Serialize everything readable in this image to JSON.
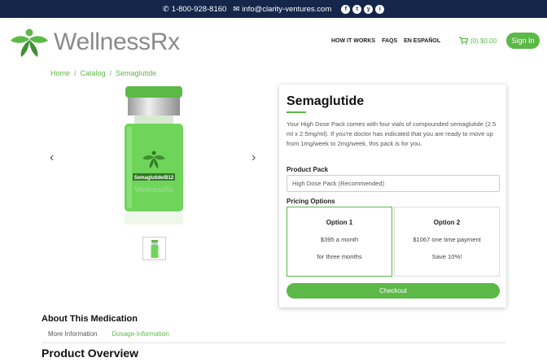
{
  "topbar": {
    "phone": "1-800-928-8160",
    "email": "info@clarity-ventures.com",
    "social": [
      "f",
      "t",
      "y",
      "i"
    ]
  },
  "brand": {
    "name_part1": "Wellness",
    "name_part2": "Rx",
    "accent": "#5cb947",
    "navy": "#14264a"
  },
  "nav": {
    "items": [
      "HOW IT WORKS",
      "FAQS",
      "EN ESPAÑOL"
    ]
  },
  "cart": {
    "label": "(0) $0.00"
  },
  "signin": {
    "label": "Sign In"
  },
  "breadcrumb": {
    "items": [
      "Home",
      "Catalog",
      "Semaglutide"
    ],
    "separator": "/"
  },
  "gallery": {
    "vial_label": "Semaglutide/B12",
    "vial_brand": "WellnessRx"
  },
  "product": {
    "title": "Semaglutide",
    "description": "Your High Dose Pack comes with four vials of compounded semaglutide (2.5 ml x 2.5mg/ml). If you're doctor has indicated that you are ready to move up from 1mg/week to 2mg/week, this pack is for you.",
    "pack_label": "Product Pack",
    "pack_value": "High Dose Pack (Recommended)",
    "pricing_label": "Pricing Options",
    "options": [
      {
        "title": "Option 1",
        "line1": "$395 a month",
        "line2": "for three months"
      },
      {
        "title": "Option 2",
        "line1": "$1067 one time payment",
        "line2": "Save 10%!"
      }
    ],
    "checkout_label": "Checkout"
  },
  "about": {
    "heading": "About This Medication",
    "tabs": [
      "More Information",
      "Dosage-Information"
    ]
  },
  "overview": {
    "heading": "Product Overview"
  }
}
